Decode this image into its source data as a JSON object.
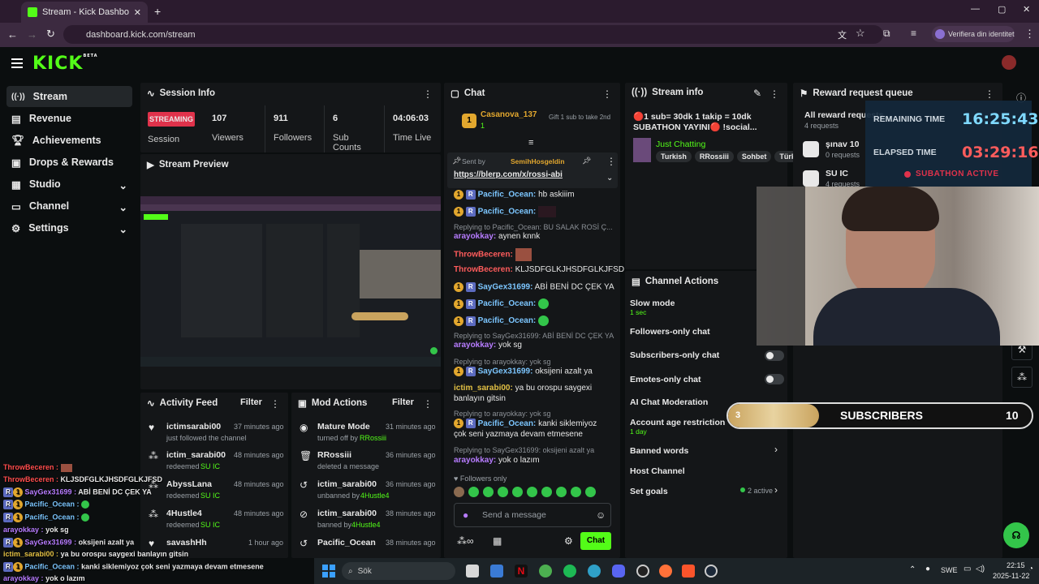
{
  "browser": {
    "tab_title": "Stream - Kick Dashboard",
    "url": "dashboard.kick.com/stream",
    "profile_label": "Verifiera din identitet"
  },
  "app": {
    "logo": "KICK",
    "logo_beta": "BETA"
  },
  "sidebar": {
    "items": [
      {
        "label": "Stream",
        "icon": "stream-icon"
      },
      {
        "label": "Revenue",
        "icon": "revenue-icon"
      },
      {
        "label": "Achievements",
        "icon": "trophy-icon"
      },
      {
        "label": "Drops & Rewards",
        "icon": "gift-icon"
      },
      {
        "label": "Studio",
        "icon": "studio-icon"
      },
      {
        "label": "Channel",
        "icon": "channel-icon"
      },
      {
        "label": "Settings",
        "icon": "gear-icon"
      }
    ]
  },
  "session": {
    "title": "Session Info",
    "status": "STREAMING",
    "status_label": "Session",
    "stats": [
      {
        "value": "107",
        "label": "Viewers"
      },
      {
        "value": "911",
        "label": "Followers"
      },
      {
        "value": "6",
        "label": "Sub Counts"
      },
      {
        "value": "04:06:03",
        "label": "Time Live"
      }
    ]
  },
  "preview": {
    "title": "Stream Preview"
  },
  "activity": {
    "title": "Activity Feed",
    "filter": "Filter",
    "items": [
      {
        "user": "ictimsarabi00",
        "time": "37 minutes ago",
        "desc": "just followed the channel",
        "extra": ""
      },
      {
        "user": "ictim_sarabi00",
        "time": "48 minutes ago",
        "desc": "redeemed",
        "extra": "SU IC"
      },
      {
        "user": "AbyssLana",
        "time": "48 minutes ago",
        "desc": "redeemed",
        "extra": "SU IC"
      },
      {
        "user": "4Hustle4",
        "time": "48 minutes ago",
        "desc": "redeemed",
        "extra": "SU IC"
      },
      {
        "user": "savashHh",
        "time": "1 hour ago",
        "desc": "",
        "extra": ""
      }
    ]
  },
  "mod": {
    "title": "Mod Actions",
    "filter": "Filter",
    "items": [
      {
        "title": "Mature Mode",
        "time": "31 minutes ago",
        "desc": "turned off by",
        "by": "RRossiii"
      },
      {
        "title": "RRossiii",
        "time": "36 minutes ago",
        "desc": "deleted a message",
        "by": ""
      },
      {
        "title": "ictim_sarabi00",
        "time": "36 minutes ago",
        "desc": "unbanned by",
        "by": "4Hustle4"
      },
      {
        "title": "ictim_sarabi00",
        "time": "38 minutes ago",
        "desc": "banned by",
        "by": "4Hustle4"
      },
      {
        "title": "Pacific_Ocean",
        "time": "38 minutes ago",
        "desc": "",
        "by": ""
      }
    ]
  },
  "chat": {
    "title": "Chat",
    "pinned_gift_user": "Casanova_137",
    "pinned_gift_count": "1",
    "gift_text": "Gift 1 sub to take 2nd",
    "pin_sent_by_label": "Sent by",
    "pin_sender": "SemihHosgeldin",
    "pin_link": "https://blerp.com/x/rossi-abi",
    "messages": [
      {
        "user": "Pacific_Ocean:",
        "text": "hb askiiim"
      },
      {
        "user": "Pacific_Ocean:",
        "text": ""
      },
      {
        "reply": "Replying to Pacific_Ocean: BU SALAK ROSİ Ç...",
        "user": "arayokkay:",
        "text": "aynen knnk"
      },
      {
        "user": "ThrowBeceren:",
        "text": ""
      },
      {
        "user": "ThrowBeceren:",
        "text": "KLJSDFGLKJHSDFGLKJFSD"
      },
      {
        "user": "SayGex31699:",
        "text": "ABİ BENİ DC ÇEK YA"
      },
      {
        "user": "Pacific_Ocean:",
        "text": ""
      },
      {
        "user": "Pacific_Ocean:",
        "text": ""
      },
      {
        "reply": "Replying to SayGex31699: ABİ BENİ DC ÇEK YA",
        "user": "arayokkay:",
        "text": "yok sg"
      },
      {
        "reply": "Replying to arayokkay: yok sg",
        "user": "SayGex31699:",
        "text": "oksijeni azalt ya"
      },
      {
        "user": "ictim_sarabi00:",
        "text": "ya bu orospu saygexi banlayın gitsin"
      },
      {
        "reply": "Replying to arayokkay: yok sg",
        "user": "Pacific_Ocean:",
        "text": "kanki siklemiyoz çok seni yazmaya devam etmesene"
      },
      {
        "reply": "Replying to SayGex31699: oksijeni azalt ya",
        "user": "arayokkay:",
        "text": "yok o lazım"
      }
    ],
    "followers_only": "Followers only",
    "input_placeholder": "Send a message",
    "send_label": "Chat"
  },
  "stream_info": {
    "title": "Stream info",
    "stream_title": "🔴1 sub= 30dk 1 takip = 10dk SUBATHON YAYINI🔴 !social...",
    "category": "Just Chatting",
    "tags": [
      "Turkish",
      "RRossiii",
      "Sohbet",
      "Türk"
    ]
  },
  "channel_actions": {
    "title": "Channel Actions",
    "items": [
      {
        "label": "Slow mode",
        "sub": "1 sec"
      },
      {
        "label": "Followers-only chat",
        "sub": ""
      },
      {
        "label": "Subscribers-only chat",
        "sub": ""
      },
      {
        "label": "Emotes-only chat",
        "sub": ""
      },
      {
        "label": "AI Chat Moderation",
        "sub": ""
      },
      {
        "label": "Account age restriction",
        "sub": "1 day"
      },
      {
        "label": "Banned words",
        "sub": ""
      },
      {
        "label": "Host Channel",
        "sub": ""
      },
      {
        "label": "Set goals",
        "sub": ""
      }
    ],
    "goals_active": "2 active"
  },
  "rewards": {
    "title": "Reward request queue",
    "all_label": "All reward requests",
    "all_count": "4 requests",
    "items": [
      {
        "name": "şınav 10",
        "count": "0 requests"
      },
      {
        "name": "SU IC",
        "count": "4 requests"
      }
    ]
  },
  "timer": {
    "remaining_label": "REMAINING TIME",
    "remaining_value": "16:25:43",
    "elapsed_label": "ELAPSED TIME",
    "elapsed_value": "03:29:16",
    "status": "SUBATHON ACTIVE"
  },
  "subgoal": {
    "current": "3",
    "label": "SUBSCRIBERS",
    "target": "10",
    "progress": 0.3
  },
  "overlay_chat": [
    {
      "user": "ThrowBeceren :",
      "text": "",
      "color": "#ff4d4d"
    },
    {
      "user": "ThrowBeceren :",
      "text": "KLJSDFGLKJHSDFGLKJFSD",
      "color": "#ff4d4d"
    },
    {
      "user": "SayGex31699 :",
      "text": "ABİ BENİ DC ÇEK YA",
      "color": "#b77cff"
    },
    {
      "user": "Pacific_Ocean :",
      "text": "",
      "color": "#7cc6ff"
    },
    {
      "user": "Pacific_Ocean :",
      "text": "",
      "color": "#7cc6ff"
    },
    {
      "user": "arayokkay :",
      "text": "yok sg",
      "color": "#b77cff"
    },
    {
      "user": "SayGex31699 :",
      "text": "oksijeni azalt ya",
      "color": "#b77cff"
    },
    {
      "user": "ictim_sarabi00 :",
      "text": "ya bu orospu saygexi banlayın gitsin",
      "color": "#e2c044"
    },
    {
      "user": "Pacific_Ocean :",
      "text": "kanki siklemiyoz çok seni yazmaya devam etmesene",
      "color": "#7cc6ff"
    },
    {
      "user": "arayokkay :",
      "text": "yok o lazım",
      "color": "#b77cff"
    }
  ],
  "taskbar": {
    "search_placeholder": "Sök",
    "lang": "SWE",
    "time": "22:15",
    "date": "2025-11-22"
  },
  "colors": {
    "kick_green": "#53fc18",
    "streaming_red": "#e0324b",
    "panel_bg": "#141618"
  }
}
